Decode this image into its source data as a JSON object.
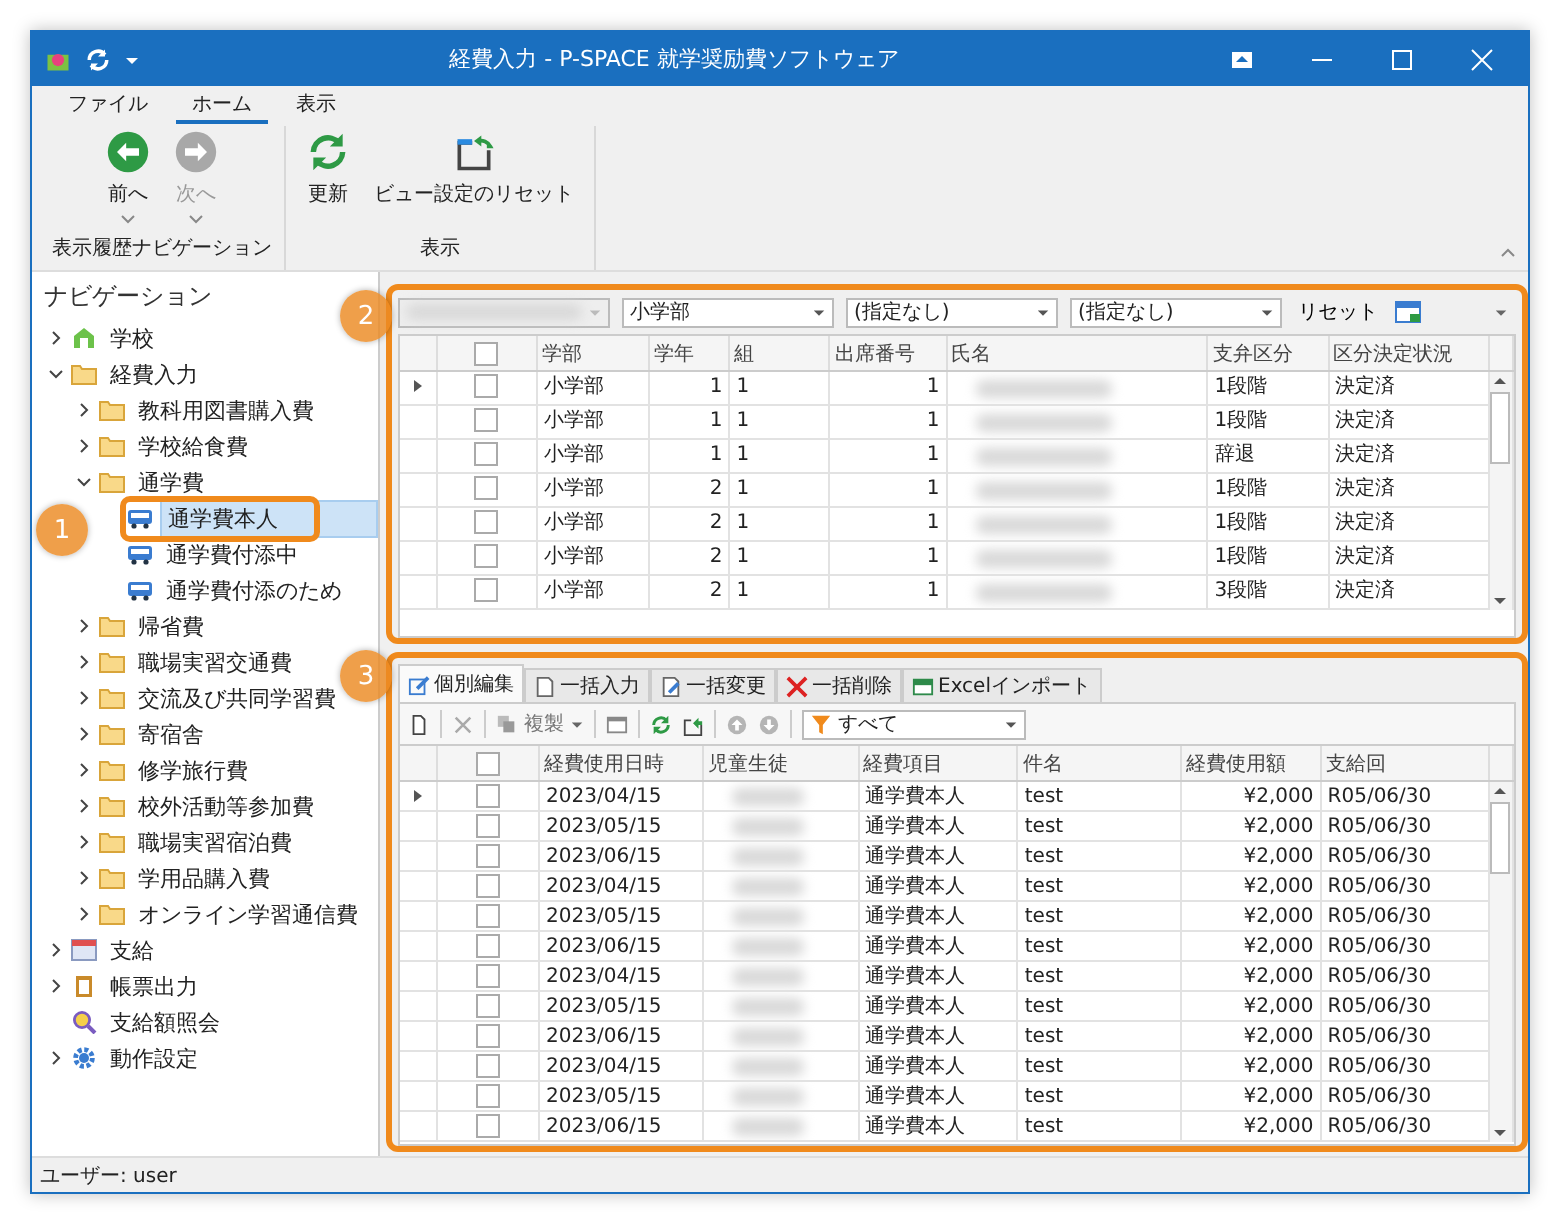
{
  "window": {
    "title": "経費入力 - P-SPACE 就学奨励費ソフトウェア"
  },
  "ribbon": {
    "tabs": [
      {
        "label": "ファイル",
        "selected": false
      },
      {
        "label": "ホーム",
        "selected": true
      },
      {
        "label": "表示",
        "selected": false
      }
    ],
    "groups": [
      {
        "label": "表示履歴ナビゲーション",
        "buttons": [
          {
            "label": "前へ",
            "kind": "back",
            "disabled": false,
            "dropdown": true
          },
          {
            "label": "次へ",
            "kind": "forward",
            "disabled": true,
            "dropdown": true
          }
        ]
      },
      {
        "label": "表示",
        "buttons": [
          {
            "label": "更新",
            "kind": "refresh",
            "disabled": false,
            "dropdown": false
          },
          {
            "label": "ビュー設定のリセット",
            "kind": "reset",
            "disabled": false,
            "dropdown": false
          }
        ]
      }
    ]
  },
  "navigation": {
    "title": "ナビゲーション",
    "items": [
      {
        "label": "学校",
        "kind": "school",
        "expanded": false,
        "selected": false
      },
      {
        "label": "経費入力",
        "kind": "folder",
        "expanded": true,
        "selected": false,
        "children": [
          {
            "label": "教科用図書購入費",
            "kind": "folder",
            "expanded": false,
            "selected": false
          },
          {
            "label": "学校給食費",
            "kind": "folder",
            "expanded": false,
            "selected": false
          },
          {
            "label": "通学費",
            "kind": "folder",
            "expanded": true,
            "selected": false,
            "children": [
              {
                "label": "通学費本人",
                "kind": "bus",
                "selected": true
              },
              {
                "label": "通学費付添中",
                "kind": "bus",
                "selected": false
              },
              {
                "label": "通学費付添のため",
                "kind": "bus",
                "selected": false
              }
            ]
          },
          {
            "label": "帰省費",
            "kind": "folder",
            "expanded": false,
            "selected": false
          },
          {
            "label": "職場実習交通費",
            "kind": "folder",
            "expanded": false,
            "selected": false
          },
          {
            "label": "交流及び共同学習費",
            "kind": "folder",
            "expanded": false,
            "selected": false
          },
          {
            "label": "寄宿舎",
            "kind": "folder",
            "expanded": false,
            "selected": false
          },
          {
            "label": "修学旅行費",
            "kind": "folder",
            "expanded": false,
            "selected": false
          },
          {
            "label": "校外活動等参加費",
            "kind": "folder",
            "expanded": false,
            "selected": false
          },
          {
            "label": "職場実習宿泊費",
            "kind": "folder",
            "expanded": false,
            "selected": false
          },
          {
            "label": "学用品購入費",
            "kind": "folder",
            "expanded": false,
            "selected": false
          },
          {
            "label": "オンライン学習通信費",
            "kind": "folder",
            "expanded": false,
            "selected": false
          }
        ]
      },
      {
        "label": "支給",
        "kind": "calendar",
        "expanded": false,
        "selected": false
      },
      {
        "label": "帳票出力",
        "kind": "clipboard",
        "expanded": false,
        "selected": false
      },
      {
        "label": "支給額照会",
        "kind": "search",
        "selected": false
      },
      {
        "label": "動作設定",
        "kind": "gear",
        "expanded": false,
        "selected": false
      }
    ]
  },
  "students_panel": {
    "filters": [
      "小学部",
      "(指定なし)",
      "(指定なし)"
    ],
    "reset_button": "リセット",
    "all_checked": false,
    "columns": [
      "学部",
      "学年",
      "組",
      "出席番号",
      "氏名",
      "支弁区分",
      "区分決定状況"
    ],
    "rows": [
      {
        "current": true,
        "checked": false,
        "department": "小学部",
        "grade": "1",
        "class": "1",
        "number": "1",
        "support": "1段階",
        "status": "決定済"
      },
      {
        "current": false,
        "checked": false,
        "department": "小学部",
        "grade": "1",
        "class": "1",
        "number": "1",
        "support": "1段階",
        "status": "決定済"
      },
      {
        "current": false,
        "checked": false,
        "department": "小学部",
        "grade": "1",
        "class": "1",
        "number": "1",
        "support": "辞退",
        "status": "決定済"
      },
      {
        "current": false,
        "checked": false,
        "department": "小学部",
        "grade": "2",
        "class": "1",
        "number": "1",
        "support": "1段階",
        "status": "決定済"
      },
      {
        "current": false,
        "checked": false,
        "department": "小学部",
        "grade": "2",
        "class": "1",
        "number": "1",
        "support": "1段階",
        "status": "決定済"
      },
      {
        "current": false,
        "checked": false,
        "department": "小学部",
        "grade": "2",
        "class": "1",
        "number": "1",
        "support": "1段階",
        "status": "決定済"
      },
      {
        "current": false,
        "checked": false,
        "department": "小学部",
        "grade": "2",
        "class": "1",
        "number": "1",
        "support": "3段階",
        "status": "決定済"
      }
    ]
  },
  "expenses_panel": {
    "tabs": [
      {
        "label": "個別編集",
        "kind": "edit",
        "selected": true
      },
      {
        "label": "一括入力",
        "kind": "doc",
        "selected": false
      },
      {
        "label": "一括変更",
        "kind": "docedit",
        "selected": false
      },
      {
        "label": "一括削除",
        "kind": "delete",
        "selected": false
      },
      {
        "label": "Excelインポート",
        "kind": "excel",
        "selected": false
      }
    ],
    "copy_button": "複製",
    "filter": "すべて",
    "all_checked": false,
    "columns": [
      "経費使用日時",
      "児童生徒",
      "経費項目",
      "件名",
      "経費使用額",
      "支給回"
    ],
    "rows": [
      {
        "current": true,
        "checked": false,
        "date": "2023/04/15",
        "item": "通学費本人",
        "subject": "test",
        "amount": "¥2,000",
        "payment": "R05/06/30"
      },
      {
        "current": false,
        "checked": false,
        "date": "2023/05/15",
        "item": "通学費本人",
        "subject": "test",
        "amount": "¥2,000",
        "payment": "R05/06/30"
      },
      {
        "current": false,
        "checked": false,
        "date": "2023/06/15",
        "item": "通学費本人",
        "subject": "test",
        "amount": "¥2,000",
        "payment": "R05/06/30"
      },
      {
        "current": false,
        "checked": false,
        "date": "2023/04/15",
        "item": "通学費本人",
        "subject": "test",
        "amount": "¥2,000",
        "payment": "R05/06/30"
      },
      {
        "current": false,
        "checked": false,
        "date": "2023/05/15",
        "item": "通学費本人",
        "subject": "test",
        "amount": "¥2,000",
        "payment": "R05/06/30"
      },
      {
        "current": false,
        "checked": false,
        "date": "2023/06/15",
        "item": "通学費本人",
        "subject": "test",
        "amount": "¥2,000",
        "payment": "R05/06/30"
      },
      {
        "current": false,
        "checked": false,
        "date": "2023/04/15",
        "item": "通学費本人",
        "subject": "test",
        "amount": "¥2,000",
        "payment": "R05/06/30"
      },
      {
        "current": false,
        "checked": false,
        "date": "2023/05/15",
        "item": "通学費本人",
        "subject": "test",
        "amount": "¥2,000",
        "payment": "R05/06/30"
      },
      {
        "current": false,
        "checked": false,
        "date": "2023/06/15",
        "item": "通学費本人",
        "subject": "test",
        "amount": "¥2,000",
        "payment": "R05/06/30"
      },
      {
        "current": false,
        "checked": false,
        "date": "2023/04/15",
        "item": "通学費本人",
        "subject": "test",
        "amount": "¥2,000",
        "payment": "R05/06/30"
      },
      {
        "current": false,
        "checked": false,
        "date": "2023/05/15",
        "item": "通学費本人",
        "subject": "test",
        "amount": "¥2,000",
        "payment": "R05/06/30"
      },
      {
        "current": false,
        "checked": false,
        "date": "2023/06/15",
        "item": "通学費本人",
        "subject": "test",
        "amount": "¥2,000",
        "payment": "R05/06/30"
      }
    ]
  },
  "status_bar": {
    "text": "ユーザー: user"
  },
  "callouts": [
    {
      "label": "1"
    },
    {
      "label": "2"
    },
    {
      "label": "3"
    }
  ]
}
